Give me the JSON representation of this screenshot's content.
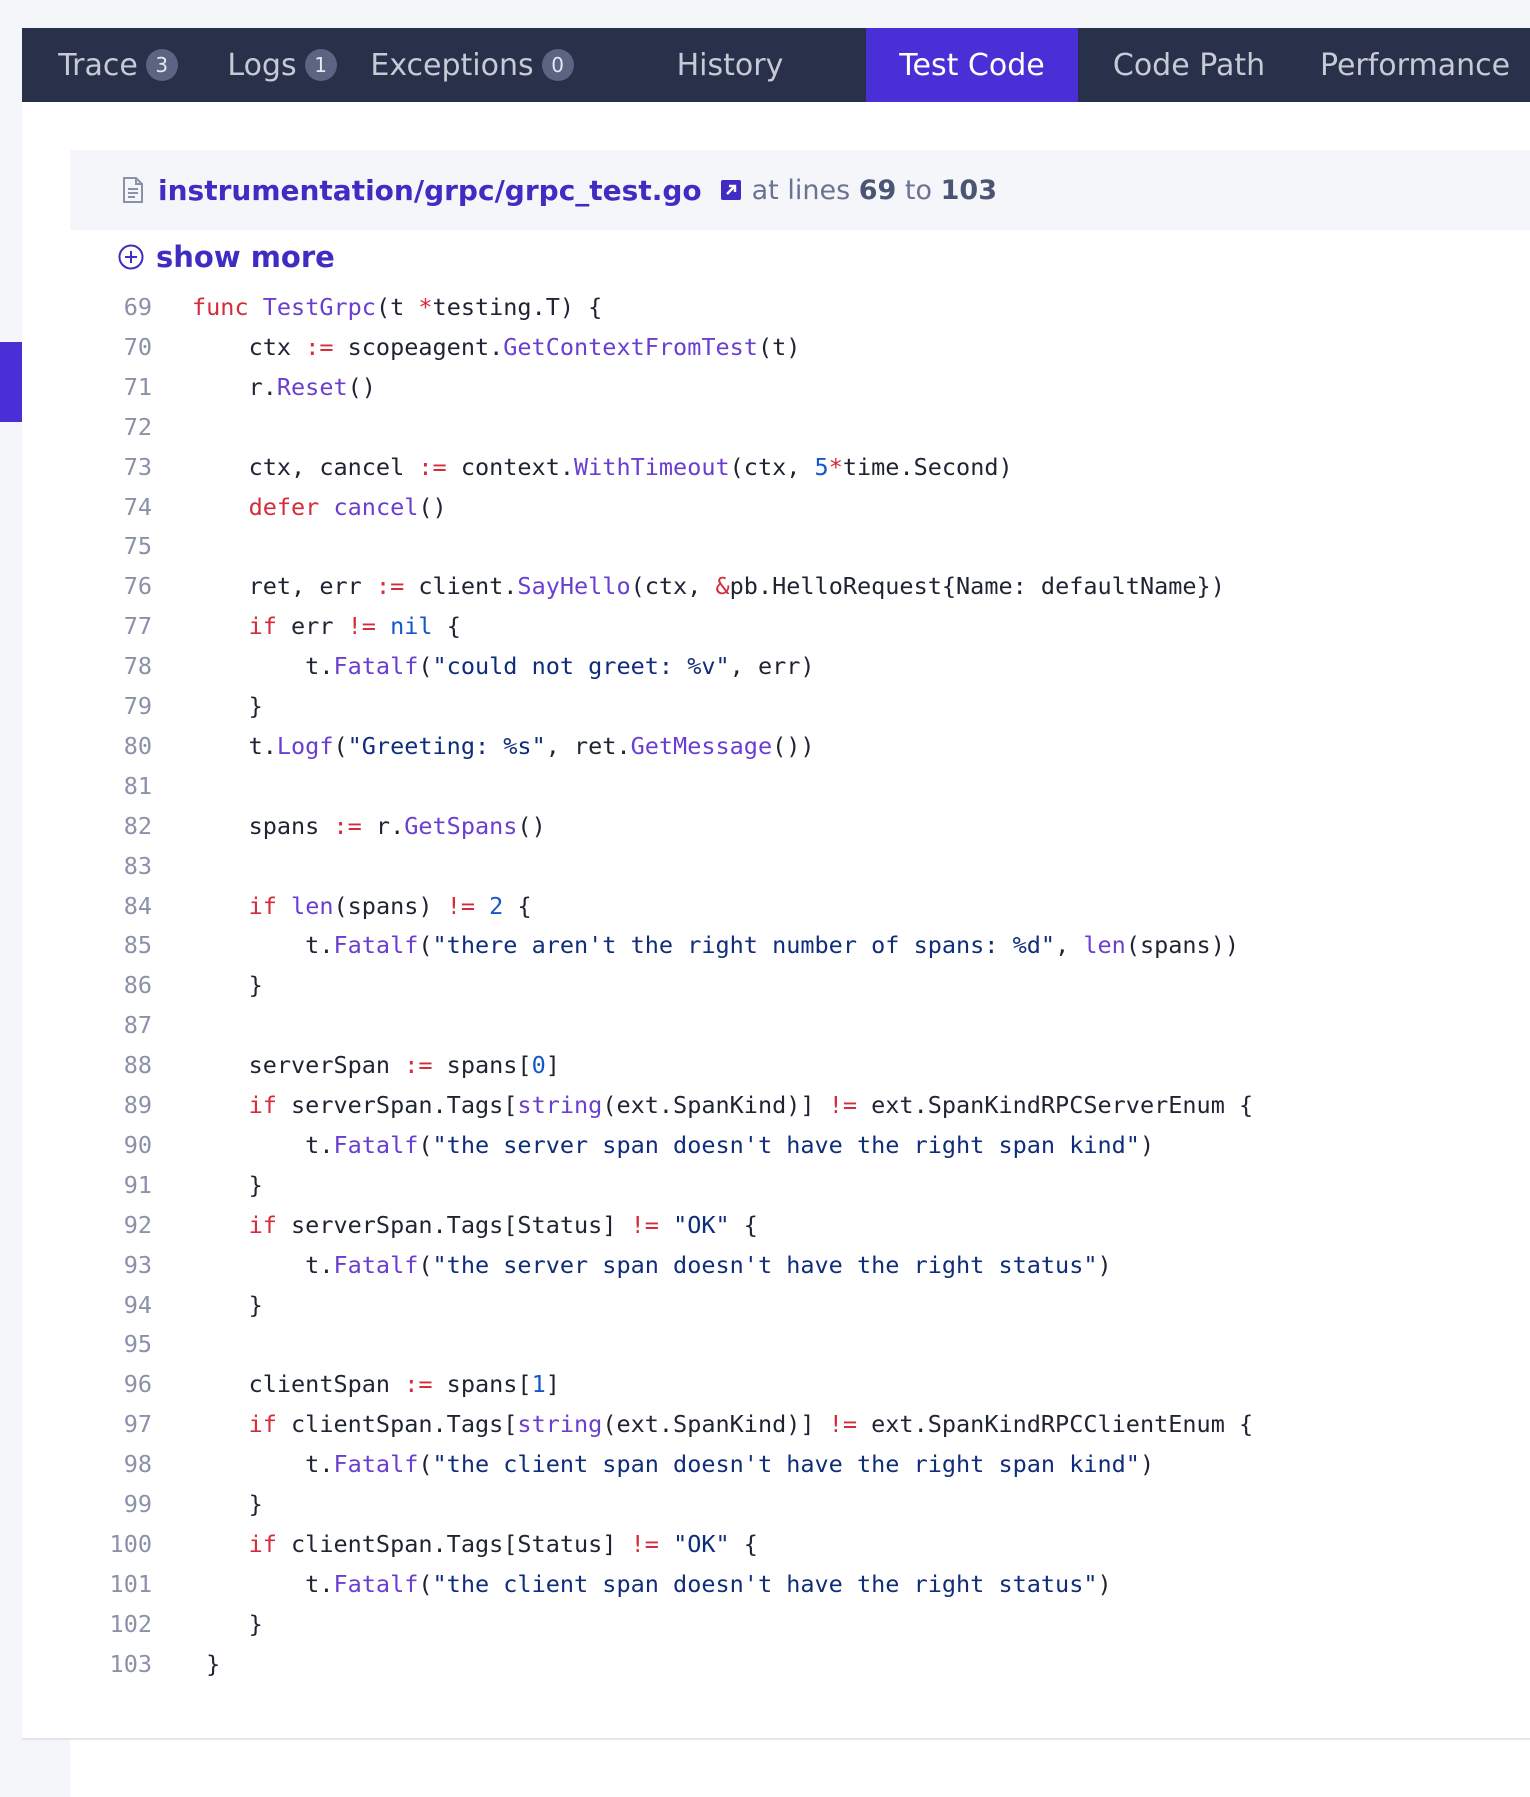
{
  "tabs": [
    {
      "label": "Trace",
      "badge": "3",
      "active": false
    },
    {
      "label": "Logs",
      "badge": "1",
      "active": false
    },
    {
      "label": "Exceptions",
      "badge": "0",
      "active": false
    },
    {
      "label": "History",
      "badge": null,
      "active": false
    },
    {
      "label": "Test Code",
      "badge": null,
      "active": true
    },
    {
      "label": "Code Path",
      "badge": null,
      "active": false
    },
    {
      "label": "Performance",
      "badge": null,
      "active": false
    }
  ],
  "file": {
    "path": "instrumentation/grpc/grpc_test.go",
    "at_lines_prefix": "at lines",
    "start_line": "69",
    "to_word": "to",
    "end_line": "103"
  },
  "show_more_label": "show more",
  "colors": {
    "accent": "#4a2fd6",
    "tabbar": "#28304a",
    "keyword": "#d52b3b",
    "function": "#6a3fd0",
    "number": "#1458c7",
    "string": "#0f2d7a"
  },
  "code_lines": [
    {
      "n": "69",
      "tokens": [
        [
          "kw",
          "func"
        ],
        [
          "",
          " "
        ],
        [
          "fn",
          "TestGrpc"
        ],
        [
          "",
          "(t "
        ],
        [
          "op",
          "*"
        ],
        [
          "",
          "testing.T) {"
        ]
      ]
    },
    {
      "n": "70",
      "tokens": [
        [
          "",
          "    ctx "
        ],
        [
          "op",
          ":="
        ],
        [
          "",
          " scopeagent."
        ],
        [
          "fn",
          "GetContextFromTest"
        ],
        [
          "",
          "(t)"
        ]
      ]
    },
    {
      "n": "71",
      "tokens": [
        [
          "",
          "    r."
        ],
        [
          "fn",
          "Reset"
        ],
        [
          "",
          "()"
        ]
      ]
    },
    {
      "n": "72",
      "tokens": []
    },
    {
      "n": "73",
      "tokens": [
        [
          "",
          "    ctx, cancel "
        ],
        [
          "op",
          ":="
        ],
        [
          "",
          " context."
        ],
        [
          "fn",
          "WithTimeout"
        ],
        [
          "",
          "(ctx, "
        ],
        [
          "num",
          "5"
        ],
        [
          "op",
          "*"
        ],
        [
          "",
          "time.Second)"
        ]
      ]
    },
    {
      "n": "74",
      "tokens": [
        [
          "",
          "    "
        ],
        [
          "kw",
          "defer"
        ],
        [
          "",
          " "
        ],
        [
          "fn",
          "cancel"
        ],
        [
          "",
          "()"
        ]
      ]
    },
    {
      "n": "75",
      "tokens": []
    },
    {
      "n": "76",
      "tokens": [
        [
          "",
          "    ret, err "
        ],
        [
          "op",
          ":="
        ],
        [
          "",
          " client."
        ],
        [
          "fn",
          "SayHello"
        ],
        [
          "",
          "(ctx, "
        ],
        [
          "op",
          "&"
        ],
        [
          "",
          "pb.HelloRequest{Name: defaultName})"
        ]
      ]
    },
    {
      "n": "77",
      "tokens": [
        [
          "",
          "    "
        ],
        [
          "kw",
          "if"
        ],
        [
          "",
          " err "
        ],
        [
          "op",
          "!="
        ],
        [
          "",
          " "
        ],
        [
          "num",
          "nil"
        ],
        [
          "",
          " {"
        ]
      ]
    },
    {
      "n": "78",
      "tokens": [
        [
          "",
          "        t."
        ],
        [
          "fn",
          "Fatalf"
        ],
        [
          "",
          "("
        ],
        [
          "str",
          "\"could not greet: %v\""
        ],
        [
          "",
          ", err)"
        ]
      ]
    },
    {
      "n": "79",
      "tokens": [
        [
          "",
          "    }"
        ]
      ]
    },
    {
      "n": "80",
      "tokens": [
        [
          "",
          "    t."
        ],
        [
          "fn",
          "Logf"
        ],
        [
          "",
          "("
        ],
        [
          "str",
          "\"Greeting: %s\""
        ],
        [
          "",
          ", ret."
        ],
        [
          "fn",
          "GetMessage"
        ],
        [
          "",
          "())"
        ]
      ]
    },
    {
      "n": "81",
      "tokens": []
    },
    {
      "n": "82",
      "tokens": [
        [
          "",
          "    spans "
        ],
        [
          "op",
          ":="
        ],
        [
          "",
          " r."
        ],
        [
          "fn",
          "GetSpans"
        ],
        [
          "",
          "()"
        ]
      ]
    },
    {
      "n": "83",
      "tokens": []
    },
    {
      "n": "84",
      "tokens": [
        [
          "",
          "    "
        ],
        [
          "kw",
          "if"
        ],
        [
          "",
          " "
        ],
        [
          "fn",
          "len"
        ],
        [
          "",
          "(spans) "
        ],
        [
          "op",
          "!="
        ],
        [
          "",
          " "
        ],
        [
          "num",
          "2"
        ],
        [
          "",
          " {"
        ]
      ]
    },
    {
      "n": "85",
      "tokens": [
        [
          "",
          "        t."
        ],
        [
          "fn",
          "Fatalf"
        ],
        [
          "",
          "("
        ],
        [
          "str",
          "\"there aren't the right number of spans: %d\""
        ],
        [
          "",
          ", "
        ],
        [
          "fn",
          "len"
        ],
        [
          "",
          "(spans))"
        ]
      ]
    },
    {
      "n": "86",
      "tokens": [
        [
          "",
          "    }"
        ]
      ]
    },
    {
      "n": "87",
      "tokens": []
    },
    {
      "n": "88",
      "tokens": [
        [
          "",
          "    serverSpan "
        ],
        [
          "op",
          ":="
        ],
        [
          "",
          " spans["
        ],
        [
          "num",
          "0"
        ],
        [
          "",
          "]"
        ]
      ]
    },
    {
      "n": "89",
      "tokens": [
        [
          "",
          "    "
        ],
        [
          "kw",
          "if"
        ],
        [
          "",
          " serverSpan.Tags["
        ],
        [
          "fn",
          "string"
        ],
        [
          "",
          "(ext.SpanKind)] "
        ],
        [
          "op",
          "!="
        ],
        [
          "",
          " ext.SpanKindRPCServerEnum {"
        ]
      ]
    },
    {
      "n": "90",
      "tokens": [
        [
          "",
          "        t."
        ],
        [
          "fn",
          "Fatalf"
        ],
        [
          "",
          "("
        ],
        [
          "str",
          "\"the server span doesn't have the right span kind\""
        ],
        [
          "",
          ")"
        ]
      ]
    },
    {
      "n": "91",
      "tokens": [
        [
          "",
          "    }"
        ]
      ]
    },
    {
      "n": "92",
      "tokens": [
        [
          "",
          "    "
        ],
        [
          "kw",
          "if"
        ],
        [
          "",
          " serverSpan.Tags[Status] "
        ],
        [
          "op",
          "!="
        ],
        [
          "",
          " "
        ],
        [
          "str",
          "\"OK\""
        ],
        [
          "",
          " {"
        ]
      ]
    },
    {
      "n": "93",
      "tokens": [
        [
          "",
          "        t."
        ],
        [
          "fn",
          "Fatalf"
        ],
        [
          "",
          "("
        ],
        [
          "str",
          "\"the server span doesn't have the right status\""
        ],
        [
          "",
          ")"
        ]
      ]
    },
    {
      "n": "94",
      "tokens": [
        [
          "",
          "    }"
        ]
      ]
    },
    {
      "n": "95",
      "tokens": []
    },
    {
      "n": "96",
      "tokens": [
        [
          "",
          "    clientSpan "
        ],
        [
          "op",
          ":="
        ],
        [
          "",
          " spans["
        ],
        [
          "num",
          "1"
        ],
        [
          "",
          "]"
        ]
      ]
    },
    {
      "n": "97",
      "tokens": [
        [
          "",
          "    "
        ],
        [
          "kw",
          "if"
        ],
        [
          "",
          " clientSpan.Tags["
        ],
        [
          "fn",
          "string"
        ],
        [
          "",
          "(ext.SpanKind)] "
        ],
        [
          "op",
          "!="
        ],
        [
          "",
          " ext.SpanKindRPCClientEnum {"
        ]
      ]
    },
    {
      "n": "98",
      "tokens": [
        [
          "",
          "        t."
        ],
        [
          "fn",
          "Fatalf"
        ],
        [
          "",
          "("
        ],
        [
          "str",
          "\"the client span doesn't have the right span kind\""
        ],
        [
          "",
          ")"
        ]
      ]
    },
    {
      "n": "99",
      "tokens": [
        [
          "",
          "    }"
        ]
      ]
    },
    {
      "n": "100",
      "tokens": [
        [
          "",
          "    "
        ],
        [
          "kw",
          "if"
        ],
        [
          "",
          " clientSpan.Tags[Status] "
        ],
        [
          "op",
          "!="
        ],
        [
          "",
          " "
        ],
        [
          "str",
          "\"OK\""
        ],
        [
          "",
          " {"
        ]
      ]
    },
    {
      "n": "101",
      "tokens": [
        [
          "",
          "        t."
        ],
        [
          "fn",
          "Fatalf"
        ],
        [
          "",
          "("
        ],
        [
          "str",
          "\"the client span doesn't have the right status\""
        ],
        [
          "",
          ")"
        ]
      ]
    },
    {
      "n": "102",
      "tokens": [
        [
          "",
          "    }"
        ]
      ]
    },
    {
      "n": "103",
      "tokens": [
        [
          "",
          " }"
        ]
      ]
    }
  ]
}
